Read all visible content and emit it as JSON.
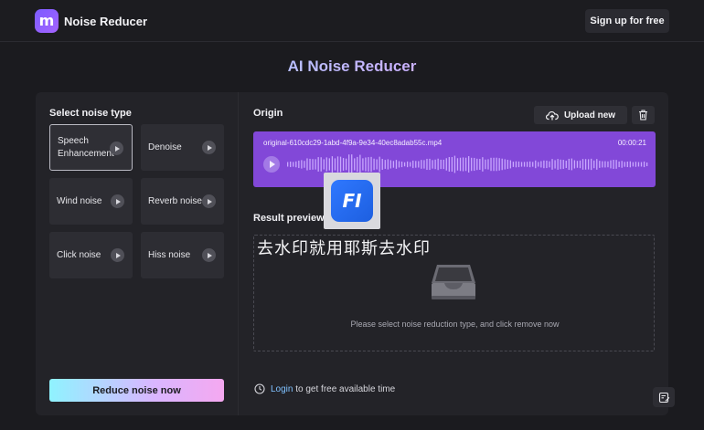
{
  "header": {
    "logo_glyph": "m",
    "app_name": "Noise Reducer",
    "signup_label": "Sign up for free"
  },
  "page_title": "AI Noise Reducer",
  "left": {
    "section_label": "Select noise type",
    "tiles": [
      {
        "label": "Speech Enhancement",
        "selected": true
      },
      {
        "label": "Denoise",
        "selected": false
      },
      {
        "label": "Wind noise",
        "selected": false
      },
      {
        "label": "Reverb noise",
        "selected": false
      },
      {
        "label": "Click noise",
        "selected": false
      },
      {
        "label": "Hiss noise",
        "selected": false
      }
    ],
    "reduce_button": "Reduce noise now"
  },
  "right": {
    "origin_label": "Origin",
    "upload_label": "Upload new",
    "audio": {
      "file_name": "original-610cdc29-1abd-4f9a-9e34-40ec8adab55c.mp4",
      "duration": "00:00:21"
    },
    "result_label": "Result preview",
    "result_message": "Please select noise reduction type, and click remove now",
    "login_link": "Login",
    "login_suffix": "to get free available time"
  },
  "watermark": {
    "badge_text": "FI",
    "overlay_text": "去水印就用耶斯去水印"
  },
  "colors": {
    "background": "#1b1b1f",
    "card": "#232328",
    "audio_bar": "#8248d8",
    "accent_gradient_start": "#8ff3ff",
    "accent_gradient_end": "#f5a8f0",
    "link": "#7fc1ff"
  },
  "icons": {
    "upload": "cloud-upload-icon",
    "delete": "trash-icon",
    "clock": "clock-icon",
    "feedback": "edit-feedback-icon",
    "empty_tray": "inbox-tray-icon",
    "play": "play-icon"
  }
}
